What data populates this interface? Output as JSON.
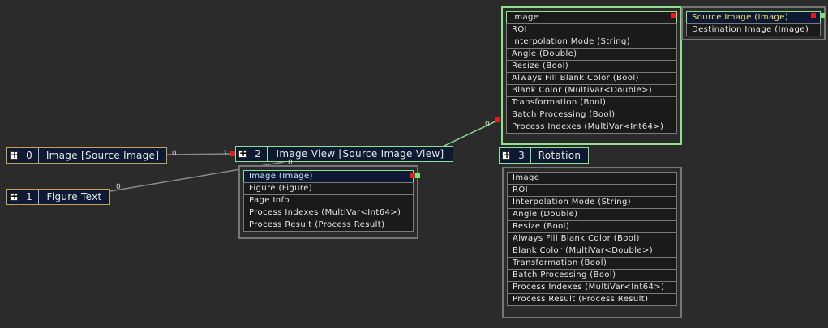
{
  "nodes": {
    "image_source": {
      "index": "0",
      "title": "Image [Source Image]",
      "out_label": "0"
    },
    "figure_text": {
      "index": "1",
      "title": "Figure Text",
      "out_label": "0"
    },
    "image_view": {
      "index": "2",
      "title": "Image View [Source Image View]",
      "in_label": "1",
      "top_label": "0"
    },
    "rotation": {
      "index": "3",
      "title": "Rotation"
    }
  },
  "panels": {
    "image_view_ports": [
      "Image (Image)",
      "Figure (Figure)",
      "Page Info",
      "Process Indexes (MultiVar<Int64>)",
      "Process Result (Process Result)"
    ],
    "rotation_inputs_top": [
      "Image",
      "ROI",
      "Interpolation Mode (String)",
      "Angle (Double)",
      "Resize (Bool)",
      "Always Fill Blank Color (Bool)",
      "Blank Color (MultiVar<Double>)",
      "Transformation (Bool)",
      "Batch Processing (Bool)",
      "Process Indexes (MultiVar<Int64>)"
    ],
    "source_outputs": [
      "Source Image (Image)",
      "Destination Image (Image)"
    ],
    "rotation_inputs_bottom": [
      "Image",
      "ROI",
      "Interpolation Mode (String)",
      "Angle (Double)",
      "Resize (Bool)",
      "Always Fill Blank Color (Bool)",
      "Blank Color (MultiVar<Double>)",
      "Transformation (Bool)",
      "Batch Processing (Bool)",
      "Process Indexes (MultiVar<Int64>)",
      "Process Result (Process Result)"
    ]
  },
  "link_labels": {
    "top_link": "0"
  },
  "colors": {
    "background": "#2b2b2b",
    "node_fill": "#0e1a33",
    "orange_border": "#c9a25a",
    "green_border": "#8fe08f",
    "port_red": "#e02020",
    "port_green": "#7de07d"
  }
}
